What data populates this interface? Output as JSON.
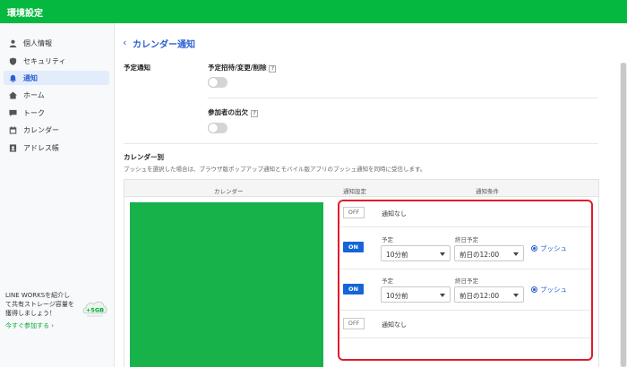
{
  "header": {
    "title": "環境設定"
  },
  "sidebar": {
    "items": [
      {
        "label": "個人情報",
        "icon": "person-icon"
      },
      {
        "label": "セキュリティ",
        "icon": "shield-icon"
      },
      {
        "label": "通知",
        "icon": "bell-icon",
        "active": true
      },
      {
        "label": "ホーム",
        "icon": "home-icon"
      },
      {
        "label": "トーク",
        "icon": "chat-icon"
      },
      {
        "label": "カレンダー",
        "icon": "calendar-icon"
      },
      {
        "label": "アドレス帳",
        "icon": "address-book-icon"
      }
    ],
    "promo": {
      "line1": "LINE WORKSを紹介し",
      "line2": "て共有ストレージ容量を",
      "line3": "獲得しましょう！",
      "link": "今すぐ参加する ›",
      "badge": "+5GB"
    }
  },
  "main": {
    "title": "カレンダー通知",
    "schedule_section": {
      "label": "予定通知",
      "invite_label": "予定招待/変更/削除",
      "attendee_label": "参加者の出欠",
      "help": "?"
    },
    "calendar_section": {
      "label": "カレンダー別",
      "description": "プッシュを選択した場合は、ブラウザ版ポップアップ通知とモバイル版アプリのプッシュ通知を同時に受信します。",
      "columns": [
        "カレンダー",
        "通知設定",
        "通知条件"
      ],
      "rows": [
        {
          "toggle": "OFF",
          "condition": "通知なし"
        },
        {
          "toggle": "ON",
          "schedule_label": "予定",
          "schedule_value": "10分前",
          "allday_label": "終日予定",
          "allday_value": "前日の12:00",
          "push": "プッシュ"
        },
        {
          "toggle": "ON",
          "schedule_label": "予定",
          "schedule_value": "10分前",
          "allday_label": "終日予定",
          "allday_value": "前日の12:00",
          "push": "プッシュ"
        },
        {
          "toggle": "OFF",
          "condition": "通知なし"
        }
      ]
    }
  },
  "colors": {
    "header": "#05b83f",
    "accent": "#2a5fd3",
    "on_button": "#1565d8",
    "highlight_box": "#e01b2b",
    "calendar_block": "#17b24a"
  }
}
